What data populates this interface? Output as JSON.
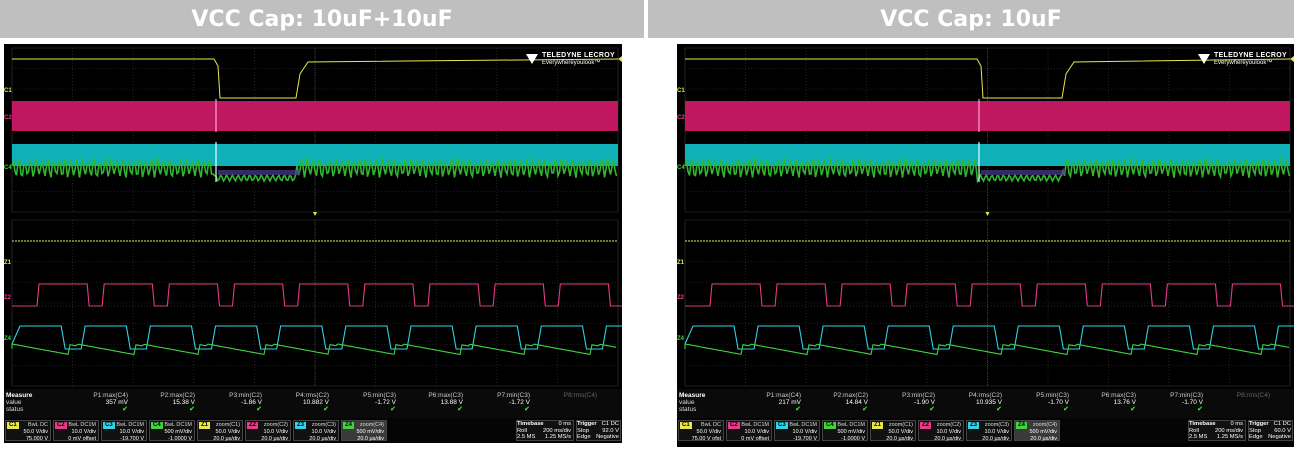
{
  "panels": [
    {
      "title": "VCC Cap: 10uF+10uF",
      "logo": {
        "brand": "TELEDYNE LECROY",
        "tagline": "Everywhereyoulook™"
      },
      "trace_labels": {
        "c1": "C1",
        "c2": "C2",
        "c4": "C4",
        "z1": "Z1",
        "z2": "Z2",
        "z4": "Z4"
      },
      "measure": {
        "header": "Measure",
        "row_value": "value",
        "row_status": "status",
        "params": [
          {
            "name": "P1:max(C4)",
            "value": "357 mV",
            "ok": true
          },
          {
            "name": "P2:max(C2)",
            "value": "15.38 V",
            "ok": true
          },
          {
            "name": "P3:min(C2)",
            "value": "-1.86 V",
            "ok": true
          },
          {
            "name": "P4:rms(C2)",
            "value": "10.882 V",
            "ok": true
          },
          {
            "name": "P5:min(C3)",
            "value": "-1.72 V",
            "ok": true
          },
          {
            "name": "P6:max(C3)",
            "value": "13.88 V",
            "ok": true
          },
          {
            "name": "P7:min(C3)",
            "value": "-1.72 V",
            "ok": true
          },
          {
            "name": "P8:rms(C4)",
            "value": "",
            "ok": false
          }
        ],
        "check": "✔"
      },
      "channels": [
        {
          "tag": "C1",
          "color": "#e8e84a",
          "line1": "BwL DC",
          "line2": "50.0 V/div",
          "line3": "75.000 V"
        },
        {
          "tag": "C2",
          "color": "#e83a8a",
          "line1": "BwL DC1M",
          "line2": "10.0 V/div",
          "line3": "0 mV offset"
        },
        {
          "tag": "C3",
          "color": "#2fd4e8",
          "line1": "BwL DC1M",
          "line2": "10.0 V/div",
          "line3": "-19.700 V"
        },
        {
          "tag": "C4",
          "color": "#3fd43f",
          "line1": "BwL DC1M",
          "line2": "500 mV/div",
          "line3": "-1.0000 V"
        },
        {
          "tag": "Z1",
          "color": "#e8e84a",
          "line1": "zoom(C1)",
          "line2": "50.0 V/div",
          "line3": "20.0 µs/div"
        },
        {
          "tag": "Z2",
          "color": "#e83a8a",
          "line1": "zoom(C2)",
          "line2": "10.0 V/div",
          "line3": "20.0 µs/div"
        },
        {
          "tag": "Z3",
          "color": "#2fd4e8",
          "line1": "zoom(C3)",
          "line2": "10.0 V/div",
          "line3": "20.0 µs/div"
        },
        {
          "tag": "Z4",
          "color": "#3fd43f",
          "line1": "zoom(C4)",
          "line2": "500 mV/div",
          "line3": "20.0 µs/div"
        }
      ],
      "timebase": {
        "label": "Timebase",
        "offset": "0 ms",
        "mode": "Roll",
        "tdiv": "200 ms/div",
        "samples": "2.5 MS",
        "rate": "1.25 MS/s"
      },
      "trigger": {
        "label": "Trigger",
        "chan": "C1 DC",
        "state": "Stop",
        "level": "92.0 V",
        "type": "Edge",
        "slope": "Negative"
      }
    },
    {
      "title": "VCC Cap: 10uF",
      "logo": {
        "brand": "TELEDYNE LECROY",
        "tagline": "Everywhereyoulook™"
      },
      "trace_labels": {
        "c1": "C1",
        "c2": "C2",
        "c4": "C4",
        "z1": "Z1",
        "z2": "Z2",
        "z4": "Z4"
      },
      "measure": {
        "header": "Measure",
        "row_value": "value",
        "row_status": "status",
        "params": [
          {
            "name": "P1:max(C4)",
            "value": "217 mV",
            "ok": true
          },
          {
            "name": "P2:max(C2)",
            "value": "14.84 V",
            "ok": true
          },
          {
            "name": "P3:min(C2)",
            "value": "-1.90 V",
            "ok": true
          },
          {
            "name": "P4:rms(C2)",
            "value": "10.935 V",
            "ok": true
          },
          {
            "name": "P5:min(C3)",
            "value": "-1.70 V",
            "ok": true
          },
          {
            "name": "P6:max(C3)",
            "value": "13.76 V",
            "ok": true
          },
          {
            "name": "P7:min(C3)",
            "value": "-1.70 V",
            "ok": true
          },
          {
            "name": "P8:rms(C4)",
            "value": "",
            "ok": false
          }
        ],
        "check": "✔"
      },
      "channels": [
        {
          "tag": "C1",
          "color": "#e8e84a",
          "line1": "BwL DC",
          "line2": "50.0 V/div",
          "line3": "75.00 V ofst"
        },
        {
          "tag": "C2",
          "color": "#e83a8a",
          "line1": "BwL DC1M",
          "line2": "10.0 V/div",
          "line3": "0 mV offset"
        },
        {
          "tag": "C3",
          "color": "#2fd4e8",
          "line1": "BwL DC1M",
          "line2": "10.0 V/div",
          "line3": "-19.700 V"
        },
        {
          "tag": "C4",
          "color": "#3fd43f",
          "line1": "BwL DC1M",
          "line2": "500 mV/div",
          "line3": "-1.0000 V"
        },
        {
          "tag": "Z1",
          "color": "#e8e84a",
          "line1": "zoom(C1)",
          "line2": "50.0 V/div",
          "line3": "20.0 µs/div"
        },
        {
          "tag": "Z2",
          "color": "#e83a8a",
          "line1": "zoom(C2)",
          "line2": "10.0 V/div",
          "line3": "20.0 µs/div"
        },
        {
          "tag": "Z3",
          "color": "#2fd4e8",
          "line1": "zoom(C3)",
          "line2": "10.0 V/div",
          "line3": "20.0 µs/div"
        },
        {
          "tag": "Z4",
          "color": "#3fd43f",
          "line1": "zoom(C4)",
          "line2": "500 mV/div",
          "line3": "20.0 µs/div"
        }
      ],
      "timebase": {
        "label": "Timebase",
        "offset": "0 ms",
        "mode": "Roll",
        "tdiv": "200 ms/div",
        "samples": "2.5 MS",
        "rate": "1.25 MS/s"
      },
      "trigger": {
        "label": "Trigger",
        "chan": "C1 DC",
        "state": "Stop",
        "level": "60.0 V",
        "type": "Edge",
        "slope": "Negative"
      }
    }
  ]
}
